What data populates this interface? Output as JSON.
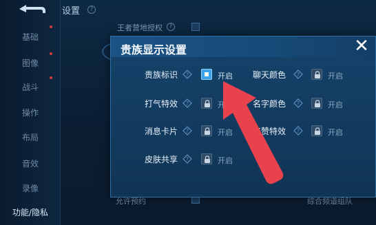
{
  "header": {
    "title": "设置"
  },
  "sidebar": {
    "items": [
      {
        "label": "基础"
      },
      {
        "label": "图像"
      },
      {
        "label": "战斗"
      },
      {
        "label": "操作"
      },
      {
        "label": "布局"
      },
      {
        "label": "音效"
      },
      {
        "label": "录像"
      },
      {
        "label": "功能/隐私"
      }
    ]
  },
  "background": {
    "row_top_label": "王者营地授权",
    "row_bottom_left": "允许预约",
    "row_bottom_right": "综合频道组队"
  },
  "modal": {
    "title": "贵族显示设置",
    "close_glyph": "✕",
    "options": [
      {
        "label": "贵族标识",
        "state": "开启",
        "locked": false
      },
      {
        "label": "聊天颜色",
        "state": "开启",
        "locked": true
      },
      {
        "label": "打气特效",
        "state": "开启",
        "locked": true
      },
      {
        "label": "名字颜色",
        "state": "开启",
        "locked": true
      },
      {
        "label": "消息卡片",
        "state": "开启",
        "locked": true
      },
      {
        "label": "点赞特效",
        "state": "开启",
        "locked": true
      },
      {
        "label": "皮肤共享",
        "state": "开启",
        "locked": true
      }
    ]
  },
  "colors": {
    "accent": "#3aa3e8",
    "arrow": "#e8424c",
    "modal_bg": "#16436b"
  }
}
